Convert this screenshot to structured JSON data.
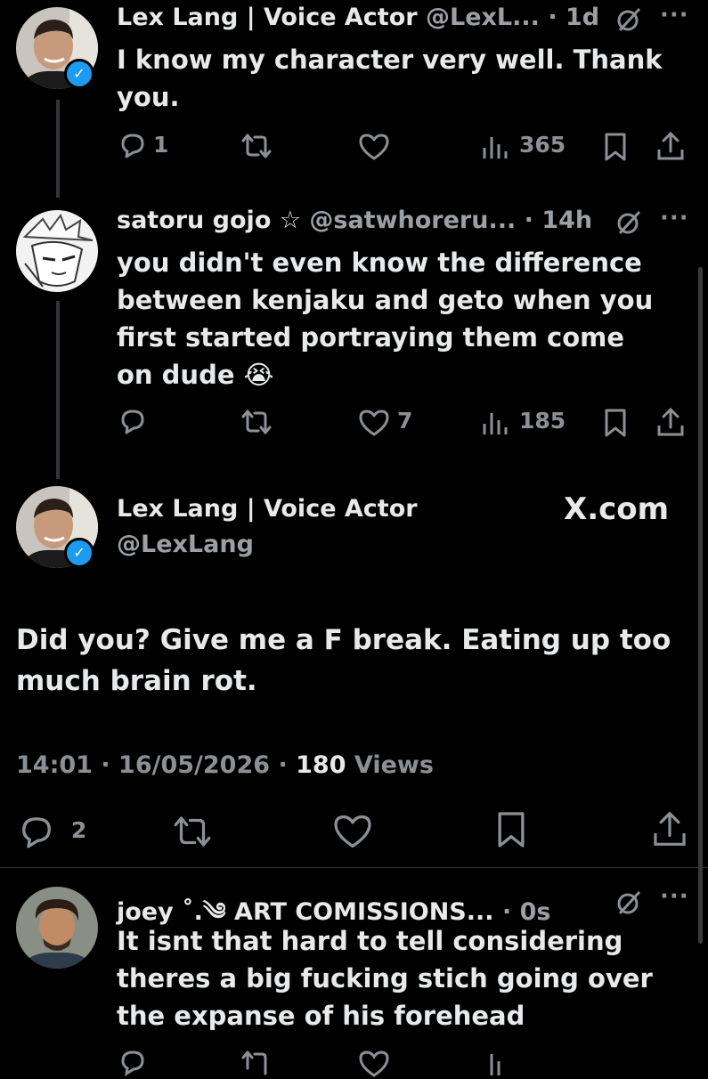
{
  "reply1": {
    "name": "Lex Lang | Voice Actor",
    "handle": "@LexL...",
    "time": "· 1d",
    "text": "I know my character very well. Thank you.",
    "replies": "1",
    "likes": "",
    "views": "365"
  },
  "reply2": {
    "name": "satoru gojo ☆",
    "handle": "@satwhoreru...",
    "time": "· 14h",
    "text": "you didn't even know the difference between kenjaku and geto when you first started portraying them come on dude 😭",
    "likes": "7",
    "views": "185"
  },
  "main": {
    "name": "Lex Lang | Voice Actor",
    "handle": "@LexLang",
    "brand": "X.com",
    "text": "Did you? Give me a F break. Eating up too much brain rot.",
    "time": "14:01",
    "date": "16/05/2026",
    "views_count": "180",
    "views_label": "Views",
    "replies": "2"
  },
  "reply3": {
    "name": "joey ˚.༄ ART COMISSIONS...",
    "time": "· 0s",
    "text": "It isnt that hard to tell considering theres a big fucking stich going over the expanse of his forehead"
  },
  "colors": {
    "bg": "#000000",
    "text": "#e7e9ea",
    "muted": "#8b9097",
    "verified": "#1d9bf0"
  },
  "icons": [
    "reply-icon",
    "retweet-icon",
    "like-icon",
    "views-icon",
    "bookmark-icon",
    "share-icon",
    "grok-icon",
    "more-icon",
    "verified-icon"
  ]
}
